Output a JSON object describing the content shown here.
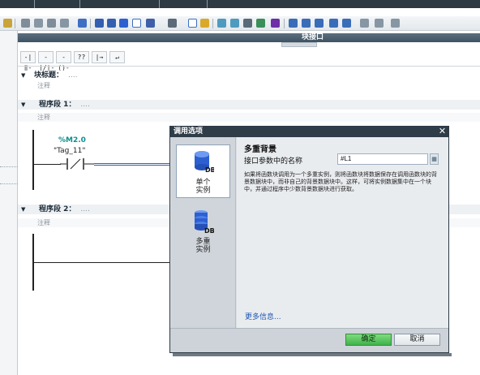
{
  "interface": {
    "title": "块接口"
  },
  "palette": [
    "-|‖-",
    "-|/|-",
    "-()-",
    "??",
    "|→",
    "↵"
  ],
  "block_title": {
    "label": "块标题：",
    "dots": "....",
    "comment": "注释"
  },
  "networks": [
    {
      "label": "程序段 1：",
      "dots": "....",
      "comment": "注释"
    },
    {
      "label": "程序段 2：",
      "dots": "....",
      "comment": "注释"
    }
  ],
  "contact": {
    "address": "%M2.0",
    "tag": "\"Tag_11\""
  },
  "dialog": {
    "title": "调用选项",
    "options": [
      {
        "label": "单个\n实例",
        "badge": "DB",
        "selected": true
      },
      {
        "label": "多重\n实例",
        "badge": "DB",
        "selected": false
      }
    ],
    "content_title": "多重背景",
    "field_label": "接口参数中的名称",
    "field_value": "#L1",
    "description": "如果将函数块调用为一个多重实例，则将函数块将数据保存在调用函数块的背景数据块中，而非自己的背景数据块中。这样，可将实例数据集中在一个块中，并通过程序中少数背景数据块进行获取。",
    "more_info": "更多信息...",
    "ok_label": "确定",
    "cancel_label": "取消"
  },
  "colors": {
    "accent": "#0f8f8f",
    "dialog_title": "#2f3d49",
    "ok_green": "#3fb24a",
    "db_blue": "#2d5fd0"
  }
}
